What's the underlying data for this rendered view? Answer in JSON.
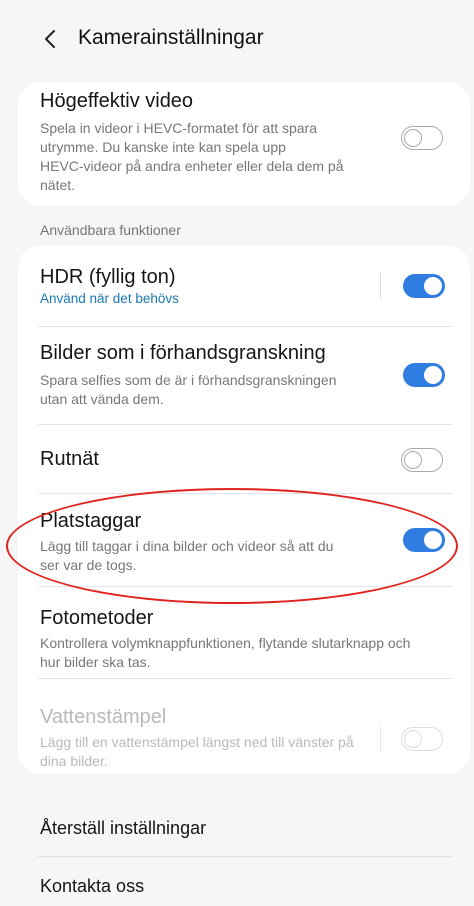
{
  "header": {
    "title": "Kamerainställningar"
  },
  "hevc": {
    "title": "Högeffektiv video",
    "desc_lines": [
      "Spela in videor i HEVC-formatet för att spara",
      "utrymme. Du kanske inte kan spela upp",
      "HEVC-videor på andra enheter eller dela dem på",
      "nätet."
    ],
    "toggle_on": false
  },
  "section": {
    "label": "Användbara funktioner"
  },
  "features": {
    "hdr": {
      "title": "HDR (fyllig ton)",
      "sub": "Använd när det behövs",
      "toggle_on": true
    },
    "preview": {
      "title": "Bilder som i förhandsgranskning",
      "desc_lines": [
        "Spara selfies som de är i förhandsgranskningen",
        "utan att vända dem."
      ],
      "toggle_on": true
    },
    "grid": {
      "title": "Rutnät",
      "toggle_on": false
    },
    "location": {
      "title": "Platstaggar",
      "desc_lines": [
        "Lägg till taggar i dina bilder och videor så att du",
        "ser var de togs."
      ],
      "toggle_on": true
    },
    "shooting": {
      "title": "Fotometoder",
      "desc_lines": [
        "Kontrollera volymknappfunktionen, flytande slutarknapp och",
        "hur bilder ska tas."
      ]
    },
    "watermark": {
      "title": "Vattenstämpel",
      "desc_lines": [
        "Lägg till en vattenstämpel längst ned till vänster på",
        "dina bilder."
      ],
      "toggle_on": false,
      "disabled": true
    }
  },
  "bottom": {
    "reset": "Återställ inställningar",
    "contact": "Kontakta oss"
  },
  "colors": {
    "accent": "#2f7de1",
    "link": "#1a78b4",
    "annotation": "#e0231c"
  },
  "icons": {
    "back": "chevron-left-icon"
  }
}
